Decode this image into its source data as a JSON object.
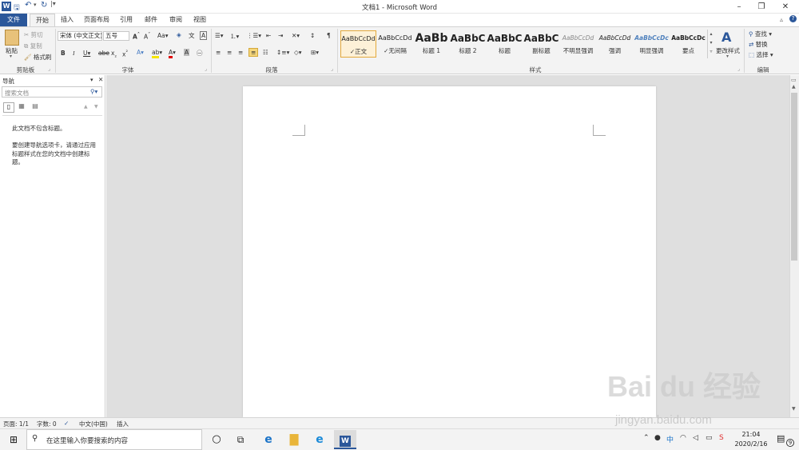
{
  "window": {
    "title": "文档1 - Microsoft Word"
  },
  "tabs": [
    {
      "label": "文件"
    },
    {
      "label": "开始"
    },
    {
      "label": "插入"
    },
    {
      "label": "页面布局"
    },
    {
      "label": "引用"
    },
    {
      "label": "邮件"
    },
    {
      "label": "审阅"
    },
    {
      "label": "视图"
    }
  ],
  "clipboard": {
    "paste": "粘贴",
    "cut": "剪切",
    "copy": "复制",
    "format_painter": "格式刷",
    "group": "剪贴板"
  },
  "font": {
    "name": "宋体 (中文正文)",
    "size": "五号",
    "group": "字体"
  },
  "paragraph": {
    "group": "段落"
  },
  "styles": {
    "group": "样式",
    "items": [
      {
        "sample": "AaBbCcDd",
        "name": "正文"
      },
      {
        "sample": "AaBbCcDd",
        "name": "无间隔"
      },
      {
        "sample": "AaBb",
        "name": "标题 1"
      },
      {
        "sample": "AaBbC",
        "name": "标题 2"
      },
      {
        "sample": "AaBbC",
        "name": "标题"
      },
      {
        "sample": "AaBbC",
        "name": "副标题"
      },
      {
        "sample": "AaBbCcDd",
        "name": "不明显强调"
      },
      {
        "sample": "AaBbCcDd",
        "name": "强调"
      },
      {
        "sample": "AaBbCcDc",
        "name": "明显强调"
      },
      {
        "sample": "AaBbCcDc",
        "name": "要点"
      }
    ],
    "change_styles": "更改样式"
  },
  "editing": {
    "find": "查找",
    "replace": "替换",
    "select": "选择",
    "group": "编辑"
  },
  "navigation": {
    "title": "导航",
    "search_placeholder": "搜索文档",
    "message1": "此文档不包含标题。",
    "message2": "要创建导航选项卡，请通过应用标题样式在您的文档中创建标题。"
  },
  "status": {
    "page": "页面: 1/1",
    "words": "字数: 0",
    "language": "中文(中国)",
    "mode": "插入"
  },
  "taskbar": {
    "search_placeholder": "在这里输入你要搜索的内容",
    "time": "21:04",
    "date": "2020/2/16",
    "notif_count": "9"
  },
  "watermark": {
    "main": "Bai du 经验",
    "sub": "jingyan.baidu.com"
  },
  "colors": {
    "accent": "#2b579a",
    "ribbon": "#f3f3f3",
    "doc_bg": "#dfdfdf"
  }
}
